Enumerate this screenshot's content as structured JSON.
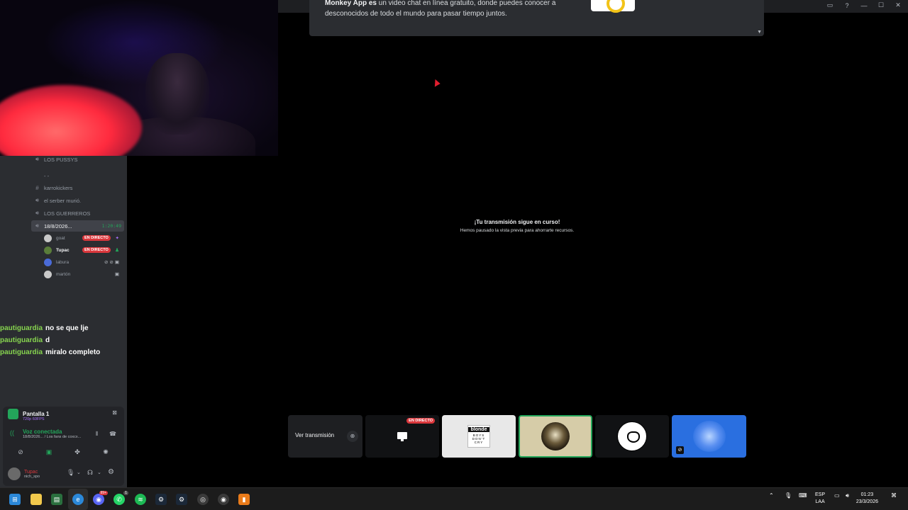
{
  "popup": {
    "brand": "Monkey App es",
    "text": "un video chat en línea gratuito, donde puedes conocer a desconocidos de todo el mundo para pasar tiempo juntos."
  },
  "window_controls": [
    "▭",
    "?",
    "—",
    "☐",
    "✕"
  ],
  "channels": [
    {
      "icon": "speaker-icon",
      "label": "LOS PUSSYS"
    },
    {
      "icon": "",
      "label": "- -"
    },
    {
      "icon": "hash-icon",
      "label": "karrokickers"
    },
    {
      "icon": "speaker-icon",
      "label": "el serber murió."
    },
    {
      "icon": "speaker-icon",
      "label": "LOS GUERREROS"
    },
    {
      "icon": "speaker-icon",
      "label": "18/8/2026...",
      "timer": "1:20:49"
    }
  ],
  "voice_users": [
    {
      "name": "goat",
      "live": "EN DIRECTO"
    },
    {
      "name": "Tupac",
      "live": "EN DIRECTO"
    },
    {
      "name": "labura",
      "live": ""
    },
    {
      "name": "martón",
      "live": ""
    }
  ],
  "chat": [
    {
      "who": "pautiguardia",
      "msg": "no se que lje"
    },
    {
      "who": "pautiguardia",
      "msg": "d"
    },
    {
      "who": "pautiguardia",
      "msg": "miralo completo"
    }
  ],
  "panel": {
    "screen_title": "Pantalla 1",
    "screen_sub": "720p 60FPS",
    "voice_label": "Voz conectada",
    "voice_sub": "18/8/2026... / Los fans de coxcx...",
    "user_name": "Tupac",
    "user_status": "nich_spo"
  },
  "center": {
    "title": "¡Tu transmisión sigue en curso!",
    "subtitle": "Hemos pausado la vista previa para ahorrarte recursos."
  },
  "tiles": {
    "ver_label": "Ver transmisión",
    "live_label": "EN DIRECTO",
    "album_title": "blonde",
    "album_sub": "BOYS DON'T CRY"
  },
  "taskbar": {
    "lang_top": "ESP",
    "lang_bottom": "LAA",
    "time": "01:23",
    "date": "23/3/2026",
    "discord_badge": "99+",
    "whatsapp_badge": "1"
  },
  "colors": {
    "sidebar_bg": "#2b2d31",
    "live_red": "#da373c",
    "voice_green": "#23a55a",
    "chat_name": "#86d34f"
  }
}
